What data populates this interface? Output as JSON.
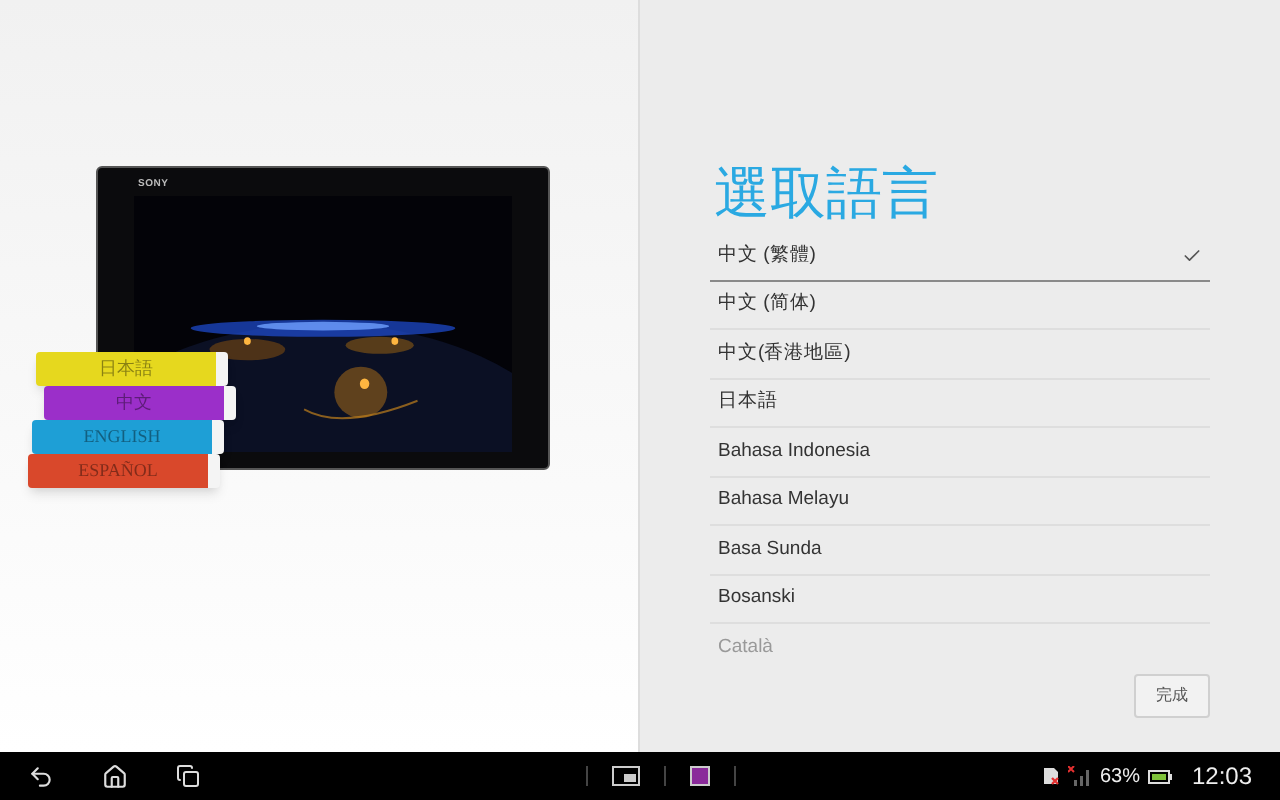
{
  "illustration": {
    "device_brand": "SONY",
    "books": [
      {
        "label": "日本語",
        "color": "#e6d81e"
      },
      {
        "label": "中文",
        "color": "#9b2fc9"
      },
      {
        "label": "ENGLISH",
        "color": "#1e9fd6"
      },
      {
        "label": "ESPAÑOL",
        "color": "#d9482b"
      }
    ]
  },
  "title": "選取語言",
  "languages": [
    {
      "label": "中文 (繁體)",
      "selected": true
    },
    {
      "label": "中文 (简体)",
      "selected": false
    },
    {
      "label": "中文(香港地區)",
      "selected": false
    },
    {
      "label": "日本語",
      "selected": false
    },
    {
      "label": "Bahasa Indonesia",
      "selected": false
    },
    {
      "label": "Bahasa Melayu",
      "selected": false
    },
    {
      "label": "Basa Sunda",
      "selected": false
    },
    {
      "label": "Bosanski",
      "selected": false
    },
    {
      "label": "Català",
      "selected": false
    }
  ],
  "done_button": "完成",
  "status_bar": {
    "battery": "63%",
    "time": "12:03"
  }
}
